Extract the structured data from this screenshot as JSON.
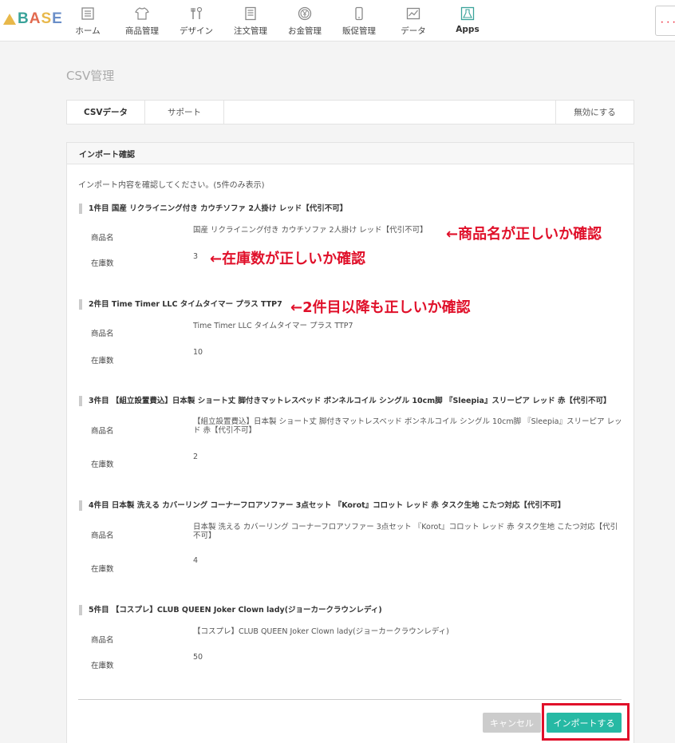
{
  "logo": {
    "text": "BASE",
    "letters": [
      "B",
      "A",
      "S",
      "E"
    ]
  },
  "nav": [
    {
      "label": "ホーム",
      "icon": "home-list-icon"
    },
    {
      "label": "商品管理",
      "icon": "tshirt-icon"
    },
    {
      "label": "デザイン",
      "icon": "tools-icon"
    },
    {
      "label": "注文管理",
      "icon": "order-document-icon"
    },
    {
      "label": "お金管理",
      "icon": "yen-coin-icon"
    },
    {
      "label": "販促管理",
      "icon": "smartphone-icon"
    },
    {
      "label": "データ",
      "icon": "chart-icon"
    },
    {
      "label": "Apps",
      "icon": "apps-flask-icon"
    }
  ],
  "page_title": "CSV管理",
  "tabs": {
    "csv_data": "CSVデータ",
    "support": "サポート",
    "disable": "無効にする"
  },
  "panel": {
    "header": "インポート確認",
    "intro": "インポート内容を確認してください。(5件のみ表示)",
    "product_label": "商品名",
    "stock_label": "在庫数",
    "items": [
      {
        "title": "1件目 国産 リクライニング付き カウチソファ 2人掛け レッド【代引不可】",
        "name": "国産 リクライニング付き カウチソファ 2人掛け レッド【代引不可】",
        "stock": "3"
      },
      {
        "title": "2件目 Time Timer LLC タイムタイマー プラス TTP7",
        "name": "Time Timer LLC タイムタイマー プラス TTP7",
        "stock": "10"
      },
      {
        "title": "3件目 【組立設置費込】日本製 ショート丈 脚付きマットレスベッド ボンネルコイル シングル 10cm脚 『Sleepia』スリーピア レッド 赤【代引不可】",
        "name": "【組立設置費込】日本製 ショート丈 脚付きマットレスベッド ボンネルコイル シングル 10cm脚 『Sleepia』スリーピア レッド 赤【代引不可】",
        "stock": "2"
      },
      {
        "title": "4件目 日本製 洗える カバーリング コーナーフロアソファー 3点セット 『Korot』コロット レッド 赤 タスク生地 こたつ対応【代引不可】",
        "name": "日本製 洗える カバーリング コーナーフロアソファー 3点セット 『Korot』コロット レッド 赤 タスク生地 こたつ対応【代引不可】",
        "stock": "4"
      },
      {
        "title": "5件目 【コスプレ】CLUB QUEEN Joker Clown lady(ジョーカークラウンレディ)",
        "name": "【コスプレ】CLUB QUEEN Joker Clown lady(ジョーカークラウンレディ)",
        "stock": "50"
      }
    ]
  },
  "buttons": {
    "cancel": "キャンセル",
    "import": "インポートする"
  },
  "annotations": {
    "product_name": "←商品名が正しいか確認",
    "stock": "←在庫数が正しいか確認",
    "second_onward": "←2件目以降も正しいか確認"
  },
  "colors": {
    "accent": "#26b9a4",
    "annotation_red": "#e0102a",
    "cancel_gray": "#cccccc"
  }
}
